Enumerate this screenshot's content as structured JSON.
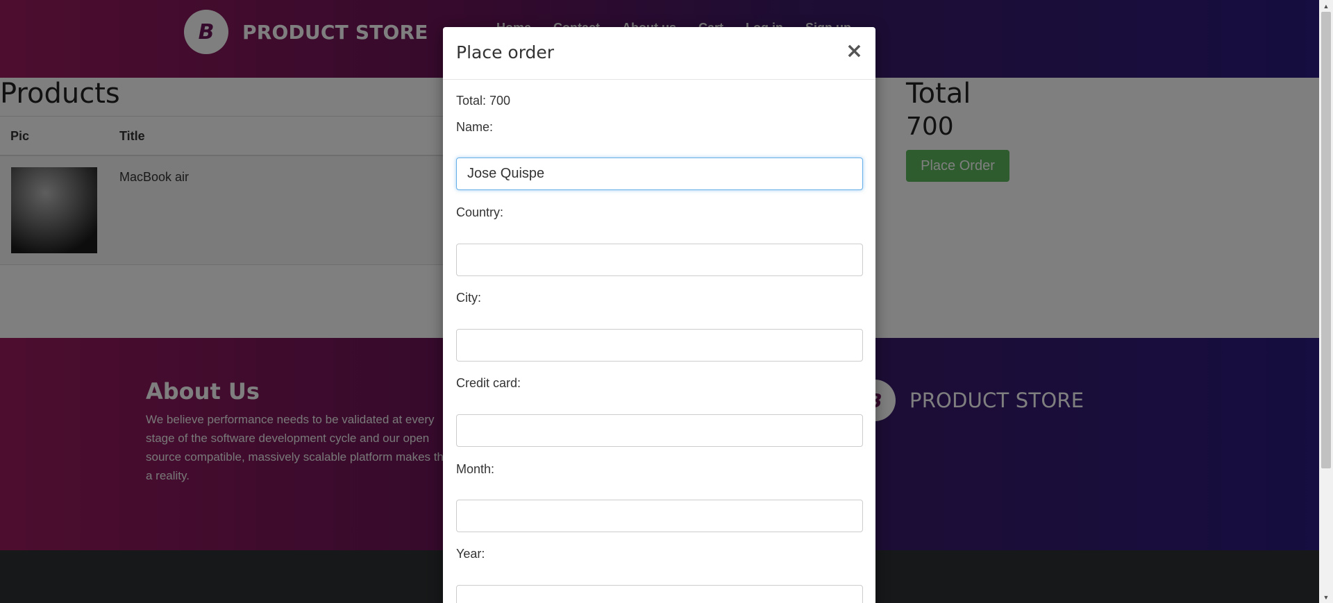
{
  "navbar": {
    "brand_logo": "B",
    "brand_name": "PRODUCT STORE",
    "links": [
      "Home",
      "Contact",
      "About us",
      "Cart",
      "Log in",
      "Sign up"
    ]
  },
  "cart": {
    "products_heading": "Products",
    "columns": [
      "Pic",
      "Title"
    ],
    "rows": [
      {
        "title": "MacBook air"
      }
    ],
    "total_heading": "Total",
    "total_value": "700",
    "place_order_label": "Place Order"
  },
  "footer": {
    "about_heading": "About Us",
    "about_text": "We believe performance needs to be validated at every stage of the software development cycle and our open source compatible, massively scalable platform makes that a reality.",
    "brand_logo": "B",
    "brand_name": "PRODUCT STORE"
  },
  "modal": {
    "title": "Place order",
    "close": "×",
    "total_line": "Total: 700",
    "fields": [
      {
        "label": "Name:",
        "value": "Jose Quispe"
      },
      {
        "label": "Country:",
        "value": ""
      },
      {
        "label": "City:",
        "value": ""
      },
      {
        "label": "Credit card:",
        "value": ""
      },
      {
        "label": "Month:",
        "value": ""
      },
      {
        "label": "Year:",
        "value": ""
      }
    ]
  },
  "scrollbar": {
    "up": "▲",
    "down": "▼"
  },
  "colors": {
    "nav_gradient_start": "#9a1b5e",
    "nav_gradient_end": "#2c1a80",
    "place_order_button": "#5cb85c",
    "focus_border": "#66afe9"
  }
}
